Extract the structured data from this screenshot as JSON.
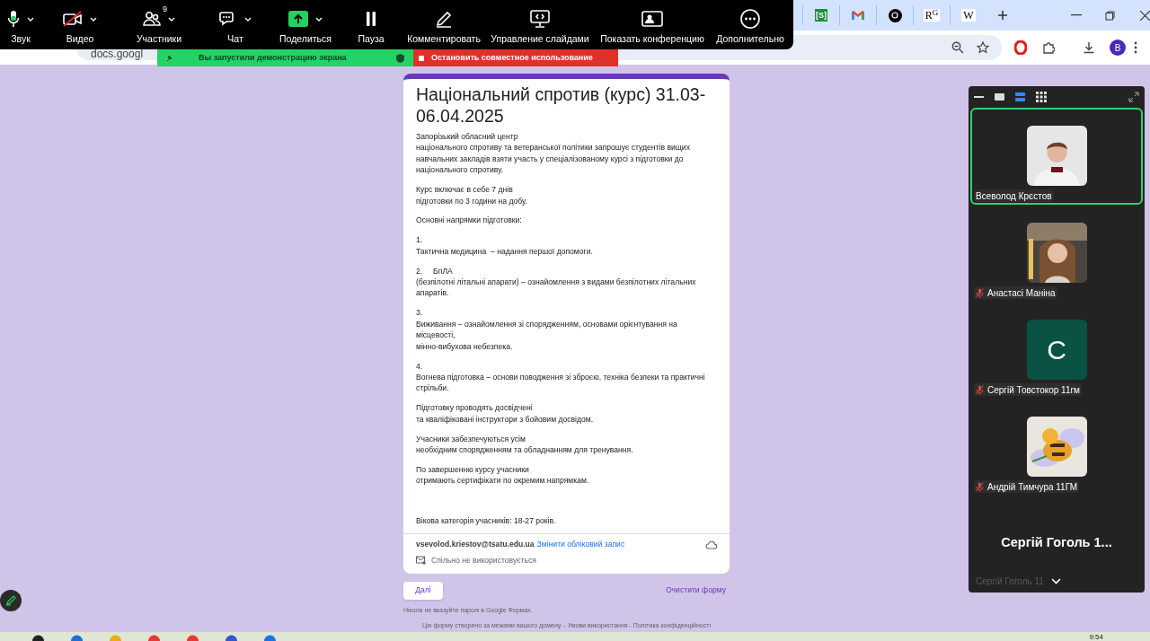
{
  "toolbar": {
    "items": [
      {
        "label": "Звук",
        "kind": "mic",
        "caret": true,
        "off": false
      },
      {
        "label": "Видео",
        "kind": "video",
        "caret": true,
        "off": true
      },
      {
        "label": "Участники",
        "kind": "participants",
        "caret": true,
        "off": false,
        "badge": "9"
      },
      {
        "label": "Чат",
        "kind": "chat",
        "caret": true,
        "off": false
      },
      {
        "label": "Поделиться",
        "kind": "share",
        "caret": true,
        "off": false
      },
      {
        "label": "Пауза",
        "kind": "pause",
        "caret": false,
        "off": false
      },
      {
        "label": "Комментировать",
        "kind": "annotate",
        "caret": false,
        "off": false
      },
      {
        "label": "Управление слайдами",
        "kind": "slides",
        "caret": false,
        "off": false
      },
      {
        "label": "Показать конференцию",
        "kind": "view",
        "caret": false,
        "off": false
      },
      {
        "label": "Дополнительно",
        "kind": "more",
        "caret": false,
        "off": false
      }
    ]
  },
  "share_banner": {
    "status": "Вы запустили демонстрацию экрана",
    "stop": "Остановить совместное использование"
  },
  "browser": {
    "tabs": [
      {
        "kind": "sheets",
        "favicon": "[S]"
      },
      {
        "kind": "gmail"
      },
      {
        "kind": "openai"
      },
      {
        "kind": "letter",
        "favicon": "R$^{G}$"
      },
      {
        "kind": "letter",
        "favicon": "W"
      }
    ],
    "address": "docs.googl",
    "profile": "B"
  },
  "form": {
    "title": "Національний спротив (курс) 31.03-06.04.2025",
    "paragraphs": [
      "Запорізький обласний центр\nнаціонального спротиву та ветеранської політики запрошує студентів вищих навчальних закладів взяти участь у спеціалізованому курсі з підготовки до національного спротиву.",
      "Курс включає в себе 7 днів\nпідготовки по 3 години на добу.",
      "Основні напрямки підготовки:",
      "1.\nТактична медицина  – надання першої допомоги.",
      "2.     БпЛА\n(безпілотні літальні апарати) – ознайомлення з видами безпілотних літальних апаратів.",
      "3.\nВиживання – ознайомлення зі спорядженням, основами орієнтування на місцевості,\nмінно-вибухова небезпека.",
      "4.\nВогнева підготовка – основи поводження зі зброєю, техніка безпеки та практичні стрільби.",
      "Підготовку проводять досвідчені\nта кваліфіковані інструктори з бойовим досвідом.",
      "Учасники забезпечуються усім\nнеобхідним спорядженням та обладнанням для тренування.",
      "По завершенню курсу учасники\nотримають сертифікати по окремим напрямкам."
    ],
    "age_note": "Вікова категорія учасників: 18-27 років.",
    "account": {
      "email": "vsevolod.kriestov@tsatu.edu.ua",
      "switch_link": "Змінити обліковий запис",
      "sharing": "Спільно не використовується"
    },
    "next_button": "Далі",
    "clear_button": "Очистити форму",
    "password_note": "Ніколи не вказуйте паролі в Google Формах.",
    "footer": "Цю форму створено за межами вашого домену. - Умови використання - Політика конфіденційності"
  },
  "meeting_panel": {
    "participants": [
      {
        "name": "Всеволод Крєстов",
        "speaking": true,
        "muted": false
      },
      {
        "name": "Анастасі Маніна",
        "speaking": false,
        "muted": true
      },
      {
        "name": "Сергій Товстокор 11гм",
        "speaking": false,
        "muted": true,
        "avatar": {
          "kind": "letter",
          "letter": "C"
        }
      },
      {
        "name": "Андрій Тимчура 11ГМ",
        "speaking": false,
        "muted": true
      }
    ],
    "overflow": {
      "title": "Сергій Гоголь 1...",
      "name": "Сергій Гоголь 11"
    }
  },
  "taskbar": {
    "time": "9:54"
  }
}
